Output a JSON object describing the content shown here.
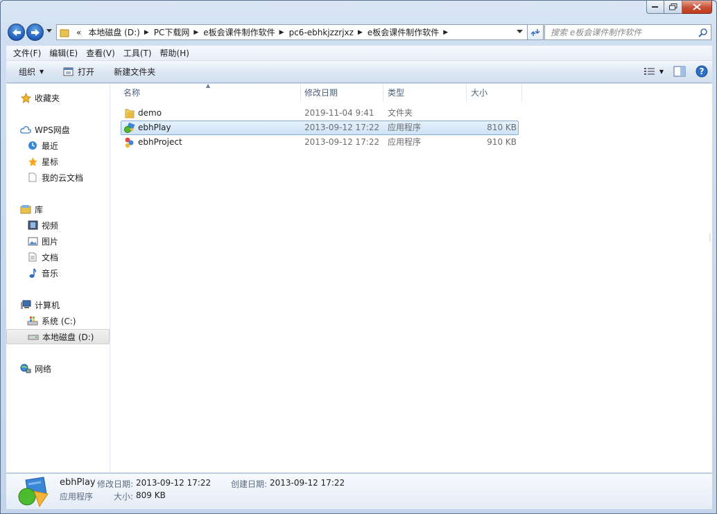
{
  "window": {
    "caption": {
      "minimize": "minimize",
      "maximize": "maximize",
      "close": "close"
    }
  },
  "navbar": {
    "breadcrumbs": [
      {
        "label": "«"
      },
      {
        "label": "本地磁盘 (D:)"
      },
      {
        "label": "PC下载网"
      },
      {
        "label": "e板会课件制作软件"
      },
      {
        "label": "pc6-ebhkjzzrjxz"
      },
      {
        "label": "e板会课件制作软件"
      }
    ],
    "search_placeholder": "搜索 e板会课件制作软件"
  },
  "menubar": {
    "items": [
      "文件(F)",
      "编辑(E)",
      "查看(V)",
      "工具(T)",
      "帮助(H)"
    ]
  },
  "cmdbar": {
    "organize": "组织",
    "open": "打开",
    "new_folder": "新建文件夹"
  },
  "sidebar": {
    "favorites": "收藏夹",
    "wps": "WPS网盘",
    "recent": "最近",
    "starred": "星标",
    "my_cloud_docs": "我的云文档",
    "libraries": "库",
    "videos": "视频",
    "pictures": "图片",
    "documents": "文档",
    "music": "音乐",
    "computer": "计算机",
    "drive_c": "系统 (C:)",
    "drive_d": "本地磁盘 (D:)",
    "network": "网络"
  },
  "columns": {
    "name": "名称",
    "modified": "修改日期",
    "type": "类型",
    "size": "大小"
  },
  "files": [
    {
      "name": "demo",
      "modified": "2019-11-04 9:41",
      "type": "文件夹",
      "size": ""
    },
    {
      "name": "ebhPlay",
      "modified": "2013-09-12 17:22",
      "type": "应用程序",
      "size": "810 KB"
    },
    {
      "name": "ebhProject",
      "modified": "2013-09-12 17:22",
      "type": "应用程序",
      "size": "910 KB"
    }
  ],
  "details": {
    "name": "ebhPlay",
    "modified_label": "修改日期:",
    "modified_value": "2013-09-12 17:22",
    "created_label": "创建日期:",
    "created_value": "2013-09-12 17:22",
    "type": "应用程序",
    "size_label": "大小:",
    "size_value": "809 KB"
  },
  "colors": {
    "selection": "#cde3f8",
    "accent": "#1e5bb8"
  }
}
